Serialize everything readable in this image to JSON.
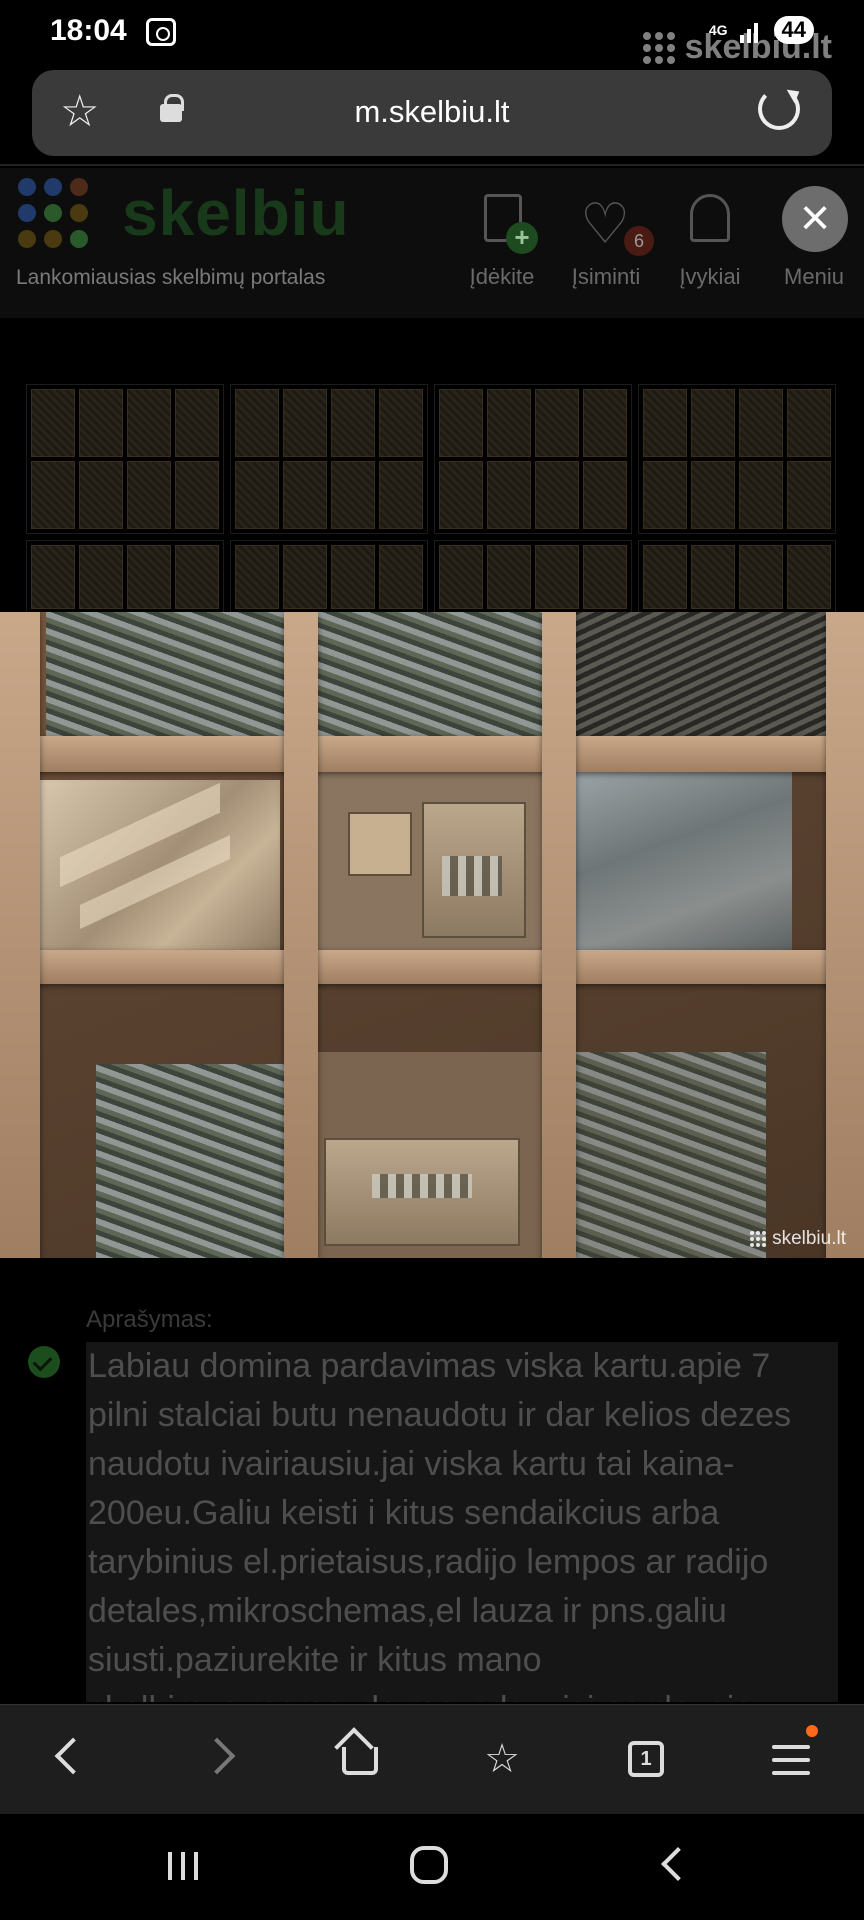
{
  "status_bar": {
    "time": "18:04",
    "network": "4G",
    "battery": "44",
    "watermark": "skelbiu.lt"
  },
  "browser": {
    "url": "m.skelbiu.lt"
  },
  "site": {
    "logo_text": "skelbiu",
    "tagline": "Lankomiausias skelbimų portalas",
    "logo_colors": [
      "#1f3a6b",
      "#1f3a6b",
      "#4d2a1a",
      "#1f3a6b",
      "#2a5a2a",
      "#4a3a10",
      "#4a3a10",
      "#4a3a10",
      "#2a5a2a"
    ],
    "actions": [
      {
        "label": "Įdėkite"
      },
      {
        "label": "Įsiminti",
        "count": "6"
      },
      {
        "label": "Įvykiai"
      },
      {
        "label": "Meniu"
      }
    ]
  },
  "photo": {
    "watermark": "skelbiu.lt"
  },
  "description": {
    "label": "Aprašymas:",
    "text": "Labiau domina pardavimas viska kartu.apie 7 pilni stalciai butu nenaudotu ir dar kelios dezes naudotu ivairiausiu.jai viska kartu tai kaina-200eu.Galiu keisti i kitus sendaikcius arba tarybinius el.prietaisus,radijo lempos ar radijo detales,mikroschemas,el lauza ir pns.galiu siusti.paziurekite ir kitus mano skelbimus,rasrasyda rasysda, visi pardavejo"
  },
  "bottom_bar": {
    "tabs_count": "1"
  }
}
